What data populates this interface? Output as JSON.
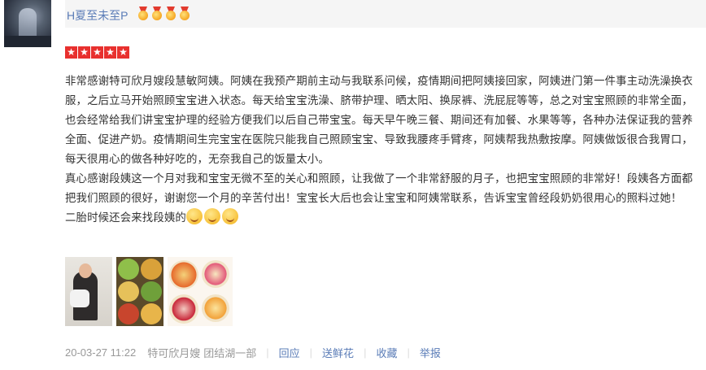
{
  "user": {
    "name": "H夏至未至P",
    "medal_count": 4
  },
  "rating": {
    "stars": 5
  },
  "review": {
    "paragraphs": [
      "非常感谢特可欣月嫂段慧敏阿姨。阿姨在我预产期前主动与我联系问候，疫情期间把阿姨接回家，阿姨进门第一件事主动洗澡换衣服，之后立马开始照顾宝宝进入状态。每天给宝宝洗澡、脐带护理、晒太阳、换尿裤、洗屁屁等等，总之对宝宝照顾的非常全面，也会经常给我们讲宝宝护理的经验方便我们以后自己带宝宝。每天早午晚三餐、期间还有加餐、水果等等，各种办法保证我的营养全面、促进产奶。疫情期间生完宝宝在医院只能我自己照顾宝宝、导致我腰疼手臂疼，阿姨帮我热敷按摩。阿姨做饭很合我胃口，每天很用心的做各种好吃的，无奈我自己的饭量太小。",
      "真心感谢段姨这一个月对我和宝宝无微不至的关心和照顾，让我做了一个非常舒服的月子，也把宝宝照顾的非常好！段姨各方面都把我们照顾的很好，谢谢您一个月的辛苦付出！宝宝长大后也会让宝宝和阿姨常联系，告诉宝宝曾经段奶奶很用心的照料过她！",
      "二胎时候还会来找段姨的"
    ],
    "emoji_count": 3
  },
  "footer": {
    "date": "20-03-27 11:22",
    "agency": "特可欣月嫂",
    "branch": "团结湖一部",
    "reply": "回应",
    "flowers": "送鲜花",
    "favorite": "收藏",
    "report": "举报"
  },
  "colors": {
    "link": "#5a7cb7",
    "star_bg": "#e8302e",
    "header_bg": "#f5f5f5"
  },
  "photos": [
    "mother-with-baby-photo",
    "meal-dishes-photo",
    "fruit-platter-photo"
  ]
}
